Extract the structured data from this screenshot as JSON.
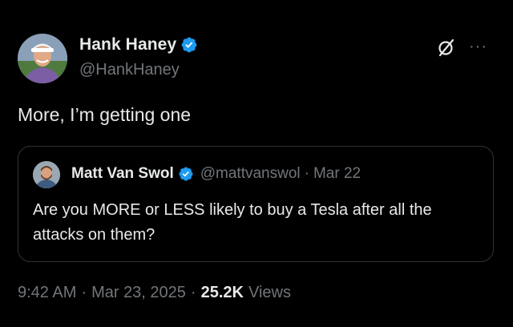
{
  "author": {
    "display_name": "Hank Haney",
    "handle": "@HankHaney",
    "verified": true,
    "avatar_icon": "golfer-avatar"
  },
  "tweet": {
    "text": "More, I’m getting one"
  },
  "quoted": {
    "display_name": "Matt Van Swol",
    "handle": "@mattvanswol",
    "separator": "·",
    "date": "Mar 22",
    "verified": true,
    "avatar_icon": "bearded-man-avatar",
    "text": "Are you MORE or LESS likely to buy a Tesla after all the attacks on them?"
  },
  "meta": {
    "time": "9:42 AM",
    "separator": "·",
    "date": "Mar 23, 2025",
    "views_count": "25.2K",
    "views_label": "Views"
  },
  "colors": {
    "background": "#000000",
    "primary_text": "#e7e9ea",
    "secondary_text": "#71767b",
    "verified_blue": "#1d9bf0",
    "border": "#2f3336"
  },
  "icons": {
    "grok": "grok-icon",
    "more": "more-dots-icon",
    "verified": "verified-badge-icon"
  }
}
